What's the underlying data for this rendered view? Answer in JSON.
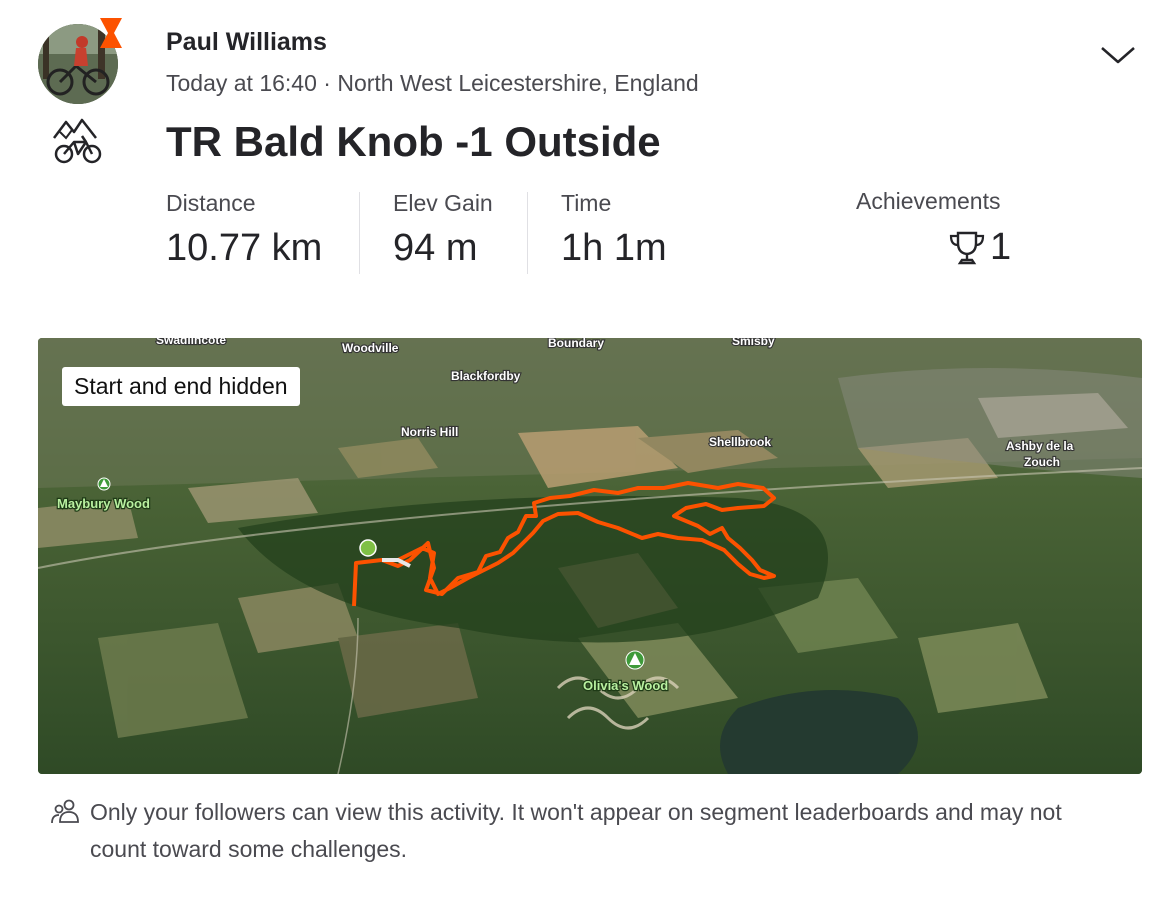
{
  "header": {
    "athlete_name": "Paul Williams",
    "meta": "Today at 16:40 · North West Leicestershire, England",
    "activity_title": "TR Bald Knob -1 Outside",
    "avatar_icon": "avatar-photo",
    "sport_icon": "mountain-bike-icon",
    "menu_icon": "chevron-down-icon"
  },
  "stats": [
    {
      "label": "Distance",
      "value": "10.77 km"
    },
    {
      "label": "Elev Gain",
      "value": "94 m"
    },
    {
      "label": "Time",
      "value": "1h 1m"
    }
  ],
  "achievements": {
    "label": "Achievements",
    "count": "1",
    "icon": "trophy-icon"
  },
  "map": {
    "overlay_label": "Start and end hidden",
    "route_color": "#fc5200",
    "places": {
      "swadlincote": "Swadlincote",
      "woodville": "Woodville",
      "boundary": "Boundary",
      "smisby": "Smisby",
      "blackfordby": "Blackfordby",
      "norris_hill": "Norris Hill",
      "shellbrook": "Shellbrook",
      "ashby1": "Ashby de la",
      "ashby2": "Zouch",
      "maybury": "Maybury Wood",
      "olivias": "Olivia's Wood"
    }
  },
  "privacy": {
    "icon": "followers-icon",
    "text": "Only your followers can view this activity. It won't appear on segment leaderboards and may not count toward some challenges."
  },
  "colors": {
    "accent": "#fc5200",
    "text": "#242428",
    "muted": "#4a4a50"
  }
}
